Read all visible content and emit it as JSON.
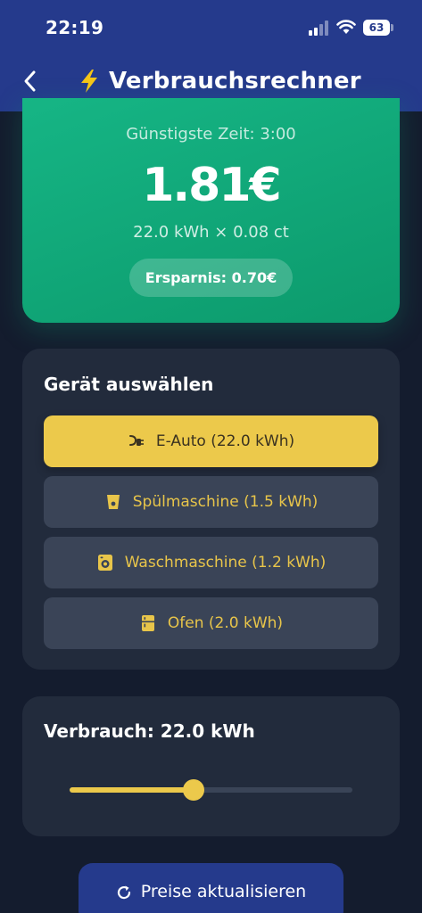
{
  "status": {
    "time": "22:19",
    "battery": "63"
  },
  "header": {
    "title": "Verbrauchsrechner"
  },
  "price_card": {
    "cheapest_time": "Günstigste Zeit: 3:00",
    "price": "1.81€",
    "calculation": "22.0 kWh × 0.08 ct",
    "saving": "Ersparnis: 0.70€"
  },
  "device_panel": {
    "title": "Gerät auswählen",
    "devices": [
      {
        "label": "E-Auto (22.0 kWh)",
        "icon": "plug-icon",
        "selected": true
      },
      {
        "label": "Spülmaschine (1.5 kWh)",
        "icon": "glass-icon",
        "selected": false
      },
      {
        "label": "Waschmaschine (1.2 kWh)",
        "icon": "washing-machine-icon",
        "selected": false
      },
      {
        "label": "Ofen (2.0 kWh)",
        "icon": "fridge-icon",
        "selected": false
      }
    ]
  },
  "usage_panel": {
    "title": "Verbrauch: 22.0 kWh",
    "slider_fraction": 0.44
  },
  "refresh_button": {
    "label": "Preise aktualisieren"
  },
  "colors": {
    "header": "#253a8c",
    "card_green": "#16b585",
    "accent_yellow": "#ecc94b",
    "panel": "#222b3c",
    "background": "#141c2e"
  }
}
